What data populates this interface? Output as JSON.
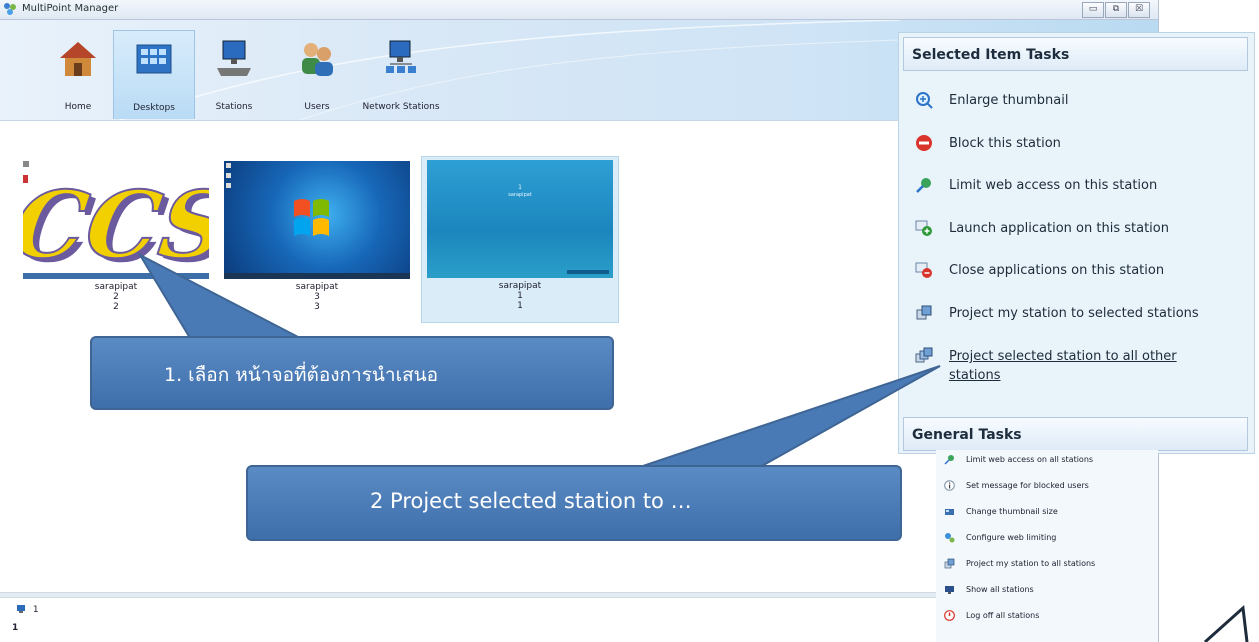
{
  "window": {
    "title": "MultiPoint Manager",
    "minimize": "▭",
    "restore": "⧉",
    "close": "☒"
  },
  "nav": [
    {
      "label": "Home",
      "icon": "home-icon"
    },
    {
      "label": "Desktops",
      "icon": "desktops-icon"
    },
    {
      "label": "Stations",
      "icon": "stations-icon"
    },
    {
      "label": "Users",
      "icon": "users-icon"
    },
    {
      "label": "Network Stations",
      "icon": "network-stations-icon"
    }
  ],
  "tiles": [
    {
      "user": "sarapipat",
      "line2": "2",
      "line3": "2",
      "wallpaper": "CCS"
    },
    {
      "user": "sarapipat",
      "line2": "3",
      "line3": "3",
      "wallpaper": "windows-7"
    },
    {
      "user": "sarapipat",
      "line2": "1",
      "line3": "1",
      "screen_num": "1",
      "screen_user": "sarapipat"
    }
  ],
  "selected_tasks": {
    "header": "Selected Item Tasks",
    "items": [
      {
        "label": "Enlarge thumbnail",
        "icon": "zoom-in-icon"
      },
      {
        "label": "Block this station",
        "icon": "block-icon"
      },
      {
        "label": "Limit web access on this station",
        "icon": "web-limit-icon"
      },
      {
        "label": "Launch application on this station",
        "icon": "launch-app-icon"
      },
      {
        "label": "Close applications on this station",
        "icon": "close-app-icon"
      },
      {
        "label": "Project my station to selected stations",
        "icon": "project-icon"
      },
      {
        "label": "Project selected station to all other",
        "label2": "stations",
        "icon": "project-all-icon"
      }
    ]
  },
  "general_tasks": {
    "header": "General Tasks",
    "items": [
      {
        "label": "Limit web access on all stations",
        "icon": "web-limit-icon"
      },
      {
        "label": "Set message for blocked users",
        "icon": "info-icon"
      },
      {
        "label": "Change thumbnail size",
        "icon": "thumbnail-size-icon"
      },
      {
        "label": "Configure web limiting",
        "icon": "configure-web-icon"
      },
      {
        "label": "Project my station to all stations",
        "icon": "project-icon"
      },
      {
        "label": "Show all stations",
        "icon": "show-stations-icon"
      },
      {
        "label": "Log off all stations",
        "icon": "log-off-icon"
      }
    ]
  },
  "bottom": {
    "row1": "1",
    "row2": "1"
  },
  "callouts": {
    "one": "1.   เลือก หน้าจอที่ต้องการนำเสนอ",
    "two": "2    Project selected station to …"
  },
  "colors": {
    "callout": "#4f7fba",
    "panel": "#e9f3fa",
    "accent": "#2b73c9"
  }
}
